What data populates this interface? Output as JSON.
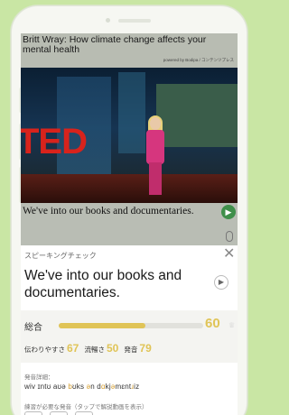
{
  "video": {
    "title": "Britt Wray: How climate change affects your mental health",
    "powered_by": "powered by Bodipa / コンテンツプレス",
    "stage_logo": "TED",
    "subtitle": "We've into our books and documentaries."
  },
  "check": {
    "title": "スピーキングチェック",
    "sentence": "We've into our books and documentaries.",
    "overall_label": "総合",
    "overall_score": 60,
    "overall_fraction": 0.6,
    "intelligibility_label": "伝わりやすさ",
    "intelligibility_score": 67,
    "fluency_label": "流暢さ",
    "fluency_score": 50,
    "pronunciation_label": "発音",
    "pronunciation_score": 79,
    "detail_label": "発音詳細：",
    "ipa_parts": [
      "wiv ɪntʊ aʊə ",
      "b",
      "ʊks ",
      "ə",
      "n d",
      "ɑ",
      "kj",
      "ə",
      "mɛnt",
      "ɹ",
      "iz"
    ],
    "practice_label": "練習が必要な発音（タップで解説動画を表示）",
    "accent_color": "#e0c457"
  }
}
